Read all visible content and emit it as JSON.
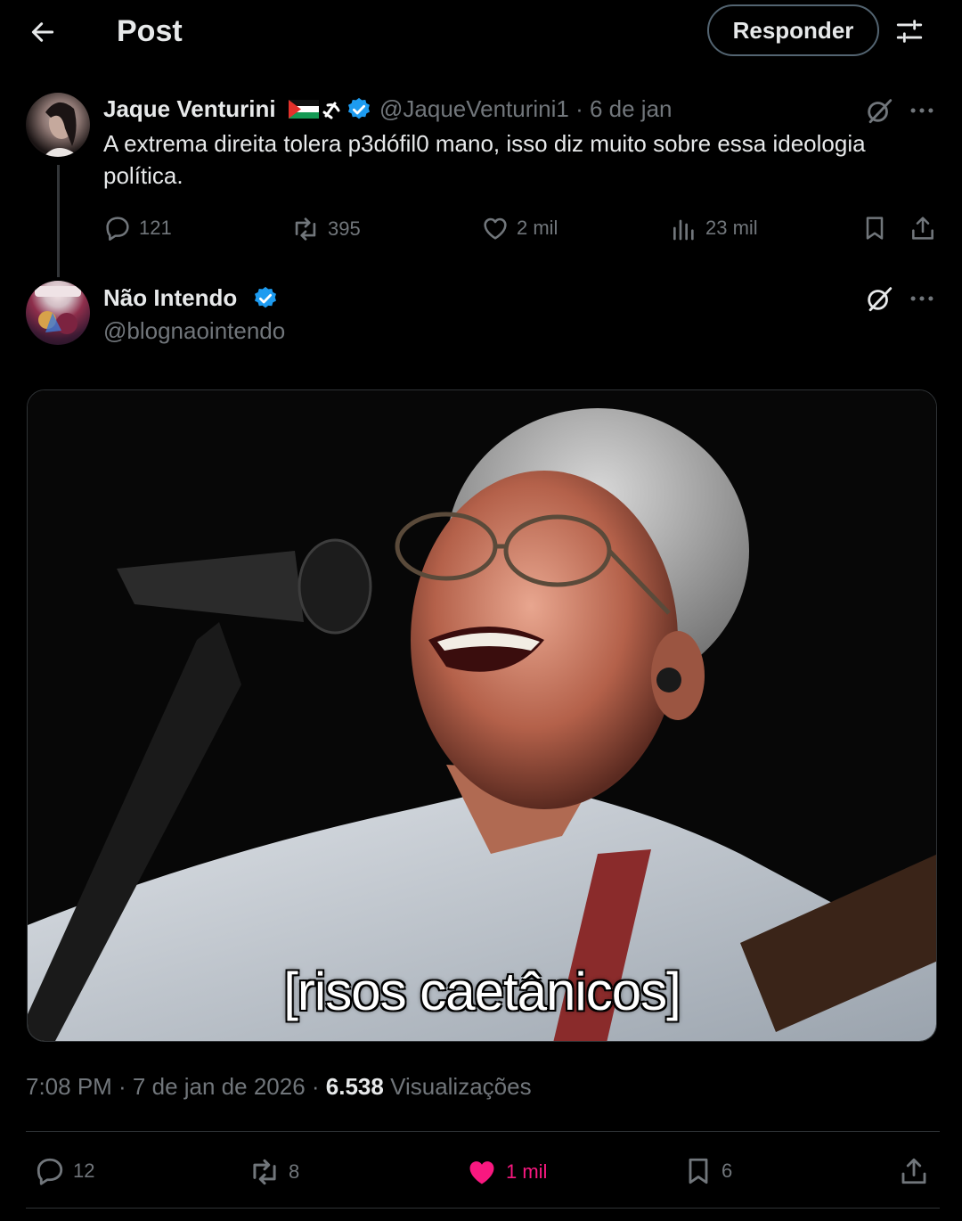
{
  "header": {
    "title": "Post",
    "reply_label": "Responder"
  },
  "parent_post": {
    "author_name": "Jaque Venturini",
    "handle_and_date": "@JaqueVenturini1 · 6 de jan",
    "text": "A extrema direita tolera p3dófil0 mano, isso diz muito sobre essa ideologia política.",
    "stats": {
      "replies": "121",
      "reposts": "395",
      "likes": "2 mil",
      "views": "23 mil"
    }
  },
  "main_post": {
    "author_name": "Não Intendo",
    "handle": "@blognaointendo",
    "image_caption": "[risos caetânicos]",
    "time": "7:08 PM · 7 de jan de 2026 · ",
    "views_count": "6.538",
    "views_label": " Visualizações",
    "stats": {
      "replies": "12",
      "reposts": "8",
      "likes": "1 mil",
      "bookmarks": "6"
    }
  },
  "colors": {
    "background": "#000000",
    "text": "#e7e9ea",
    "secondary": "#71767b",
    "verified": "#1d9bf0",
    "like_active": "#f91880"
  }
}
